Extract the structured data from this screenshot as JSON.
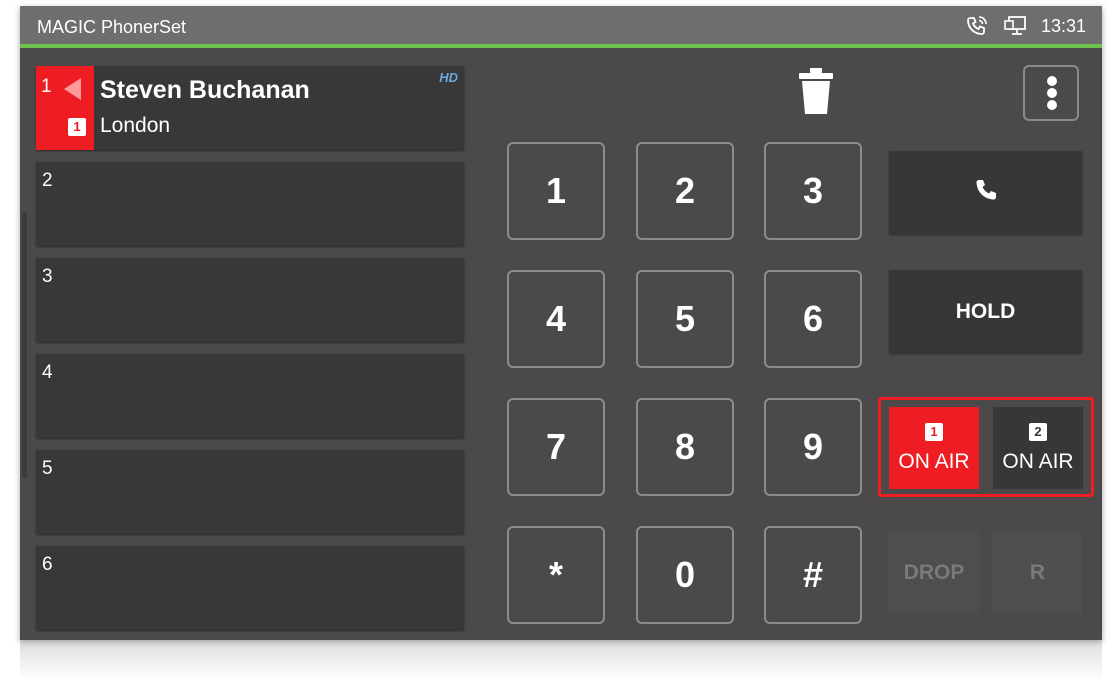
{
  "statusbar": {
    "app_title": "MAGIC PhonerSet",
    "time": "13:31",
    "icons": [
      "phone-ringing-icon",
      "network-monitor-icon"
    ]
  },
  "lines": [
    {
      "number": "1",
      "active": true,
      "caller_name": "Steven Buchanan",
      "caller_city": "London",
      "badge": "1",
      "hd": "HD"
    },
    {
      "number": "2"
    },
    {
      "number": "3"
    },
    {
      "number": "4"
    },
    {
      "number": "5"
    },
    {
      "number": "6"
    }
  ],
  "toolbar": {
    "trash_icon": "trash-icon",
    "menu_icon": "kebab-menu-icon"
  },
  "keypad": [
    "1",
    "2",
    "3",
    "4",
    "5",
    "6",
    "7",
    "8",
    "9",
    "*",
    "0",
    "#"
  ],
  "actions": {
    "call_icon": "phone-handset-icon",
    "hold_label": "HOLD",
    "onair_1": {
      "badge": "1",
      "label": "ON AIR"
    },
    "onair_2": {
      "badge": "2",
      "label": "ON AIR"
    },
    "drop_label": "DROP",
    "r_label": "R"
  },
  "colors": {
    "accent_red": "#ee1c23",
    "status_green": "#6cc24a",
    "background": "#4b4949"
  }
}
